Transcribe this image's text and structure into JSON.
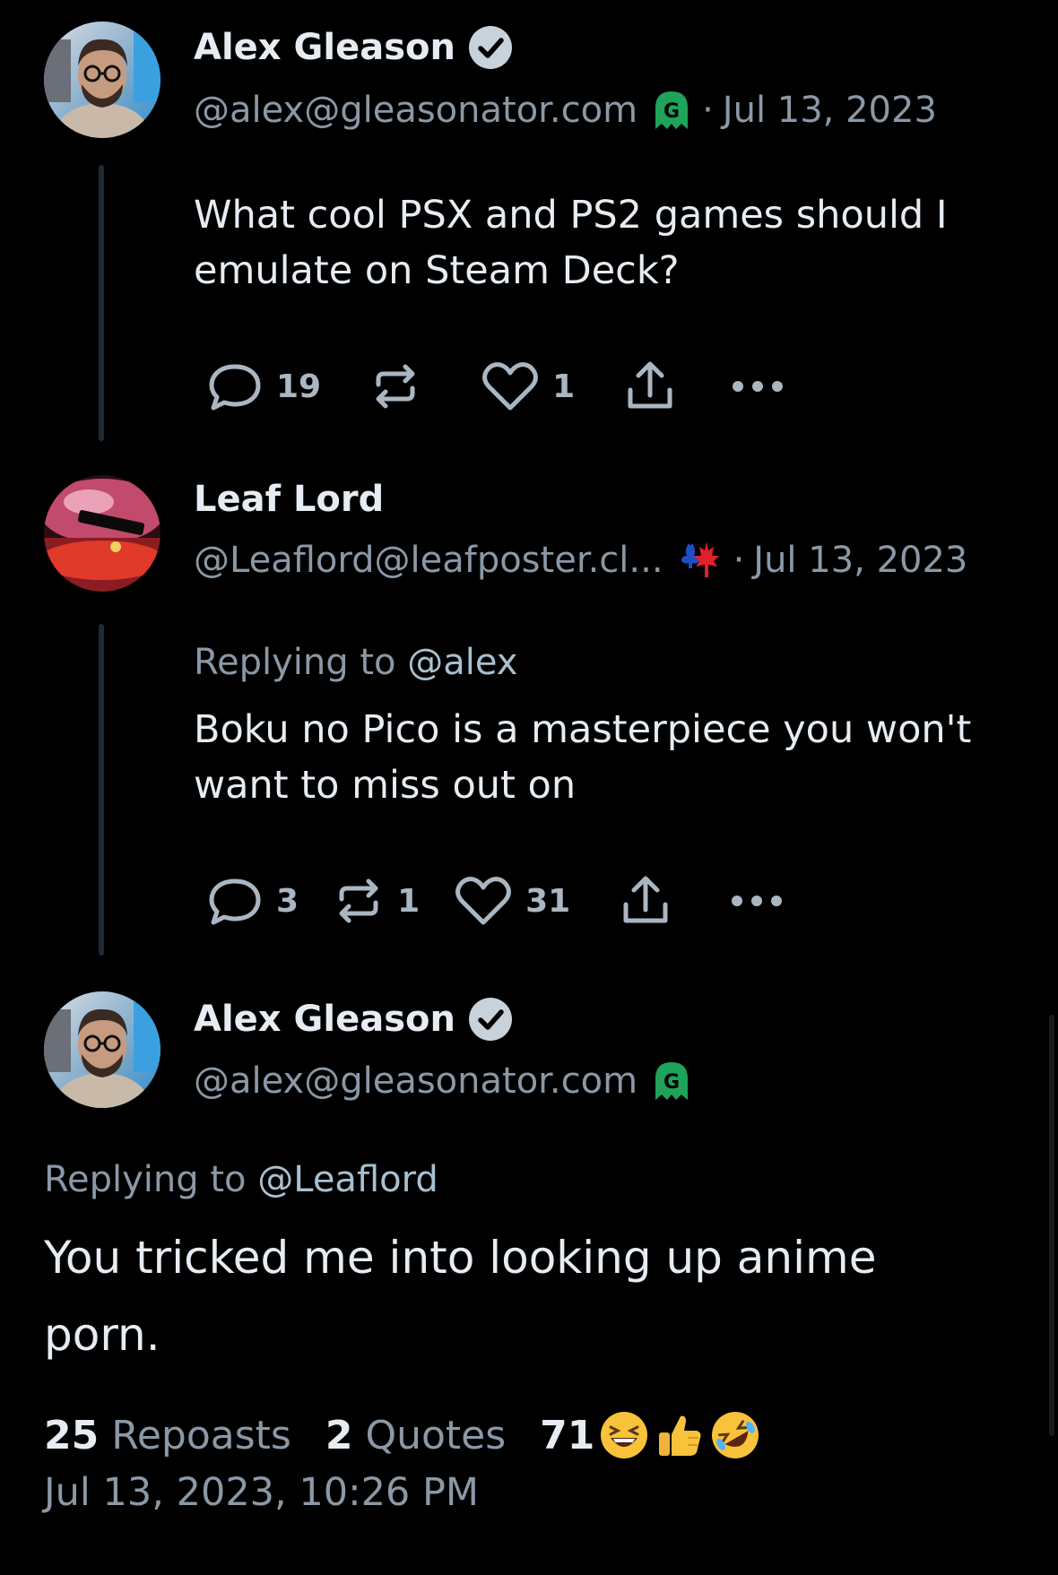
{
  "posts": [
    {
      "author": "Alex Gleason",
      "handle": "@alex@gleasonator.com",
      "separator": "·",
      "date": "Jul 13, 2023",
      "text": "What cool PSX and PS2 games should I emulate on Steam Deck?",
      "replies": "19",
      "reposts": "",
      "likes": "1"
    },
    {
      "author": "Leaf Lord",
      "handle": "@Leaflord@leafposter.cl...",
      "separator": "·",
      "date": "Jul 13, 2023",
      "replying_prefix": "Replying to",
      "replying_mention": "@alex",
      "text": "Boku no Pico is a masterpiece you won't want to miss out on",
      "replies": "3",
      "reposts": "1",
      "likes": "31"
    }
  ],
  "focus": {
    "author": "Alex Gleason",
    "handle": "@alex@gleasonator.com",
    "replying_prefix": "Replying to",
    "replying_mention": "@Leaflord",
    "text": "You tricked me into looking up anime porn.",
    "reposts_count": "25",
    "reposts_label": "Repoasts",
    "quotes_count": "2",
    "quotes_label": "Quotes",
    "reactions_count": "71",
    "reaction_emojis": [
      "laughing-emoji",
      "thumbs-up-emoji",
      "rolling-laughing-emoji"
    ],
    "timestamp": "Jul 13, 2023, 10:26 PM"
  },
  "colors": {
    "background": "#000000",
    "text": "#e6ecf2",
    "muted": "#8b98a6",
    "thread_line": "#1e2c38",
    "verified": "#c8d2da",
    "ghost_badge": "#1fa35a"
  },
  "icons": {
    "reply": "reply-icon",
    "repost": "repost-icon",
    "like": "heart-icon",
    "share": "share-icon",
    "more": "more-icon",
    "verified": "verified-icon",
    "ghost": "ghost-badge-icon",
    "flag": "quebec-canada-flag-icon"
  }
}
